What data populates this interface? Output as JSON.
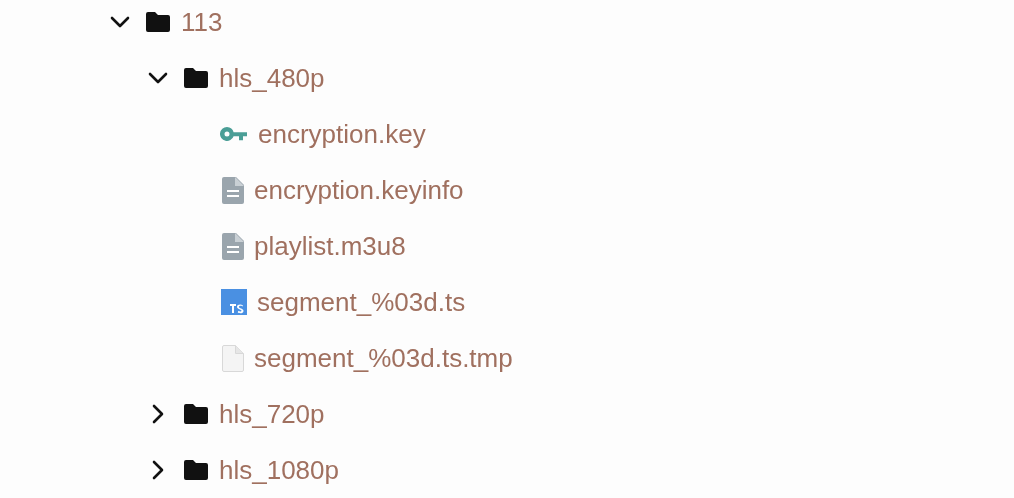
{
  "tree": [
    {
      "kind": "folder",
      "name": "113",
      "expanded": true,
      "children": [
        {
          "kind": "folder",
          "name": "hls_480p",
          "expanded": true,
          "children": [
            {
              "kind": "key",
              "name": "encryption.key"
            },
            {
              "kind": "text",
              "name": "encryption.keyinfo"
            },
            {
              "kind": "text",
              "name": "playlist.m3u8"
            },
            {
              "kind": "ts",
              "name": "segment_%03d.ts"
            },
            {
              "kind": "blank",
              "name": "segment_%03d.ts.tmp"
            }
          ]
        },
        {
          "kind": "folder",
          "name": "hls_720p",
          "expanded": false
        },
        {
          "kind": "folder",
          "name": "hls_1080p",
          "expanded": false
        }
      ]
    }
  ]
}
